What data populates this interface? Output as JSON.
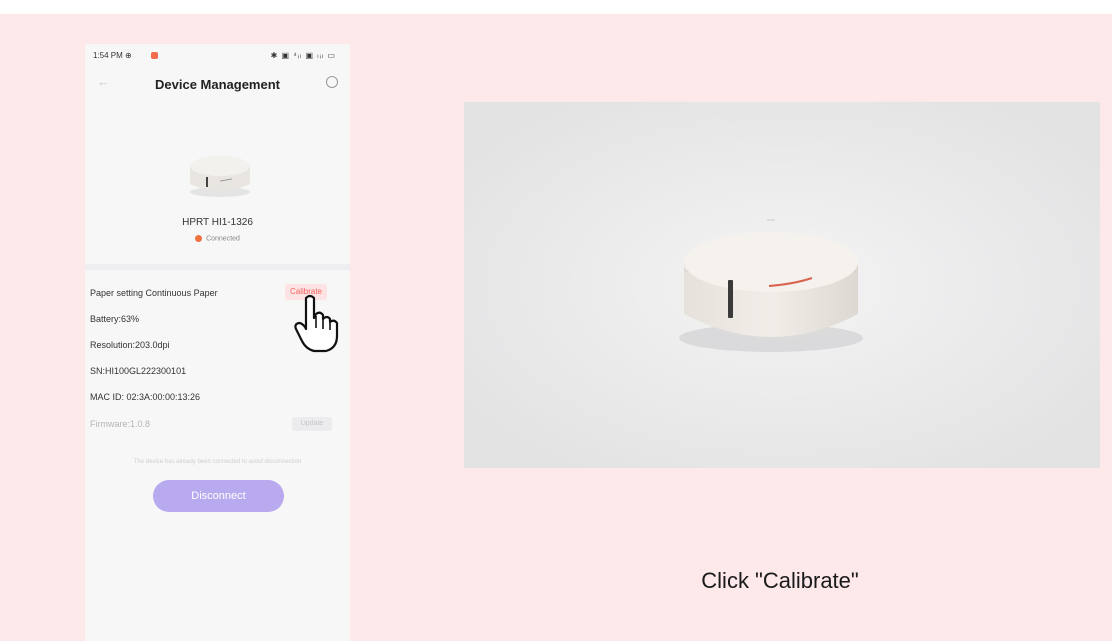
{
  "phone": {
    "status_time": "1:54 PM ⊕",
    "status_icons": "✱ ▣ ⁴ᵢₗ ▣ ₗᵢₗ ▭",
    "header_title": "Device Management",
    "device_name": "HPRT HI1-1326",
    "connection_status": "Connected",
    "info_rows": [
      {
        "label": "Paper setting Continuous Paper"
      },
      {
        "label": "Battery:63%"
      },
      {
        "label": "Resolution:203.0dpi"
      },
      {
        "label": "SN:HI100GL222300101"
      },
      {
        "label": "MAC ID:  02:3A:00:00:13:26"
      },
      {
        "label": "Firmware:1.0.8"
      }
    ],
    "calibrate_label": "Calibrate",
    "update_label": "Update",
    "hint_text": "The device has already been connected to avoid disconnection",
    "disconnect_label": "Disconnect"
  },
  "caption": "Click \"Calibrate\"",
  "colors": {
    "background": "#fde8ea",
    "accent_red": "#f26161",
    "disconnect_purple": "#b9a9ee",
    "connected_orange": "#f0703f"
  },
  "icons": {
    "back": "back-arrow-icon",
    "more": "more-circle-icon",
    "pointer": "hand-pointer-icon"
  }
}
